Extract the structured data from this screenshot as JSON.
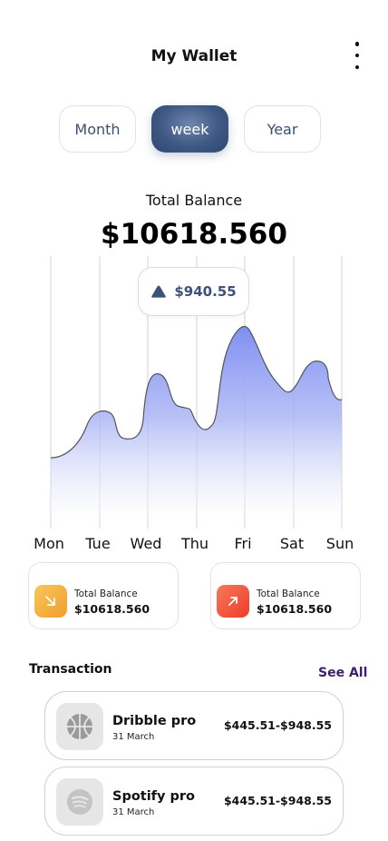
{
  "header": {
    "title": "My Wallet"
  },
  "tabs": [
    {
      "label": "Month",
      "active": false
    },
    {
      "label": "week",
      "active": true
    },
    {
      "label": "Year",
      "active": false
    }
  ],
  "balance": {
    "label": "Total Balance",
    "amount": "$10618.560"
  },
  "chart_data": {
    "type": "area",
    "categories": [
      "Mon",
      "Tue",
      "Wed",
      "Thu",
      "Fri",
      "Sat",
      "Sun"
    ],
    "tooltip": {
      "value": "$940.55",
      "category": "Fri"
    },
    "line_color": "#555555",
    "fill_top_color": "#7f8ff2"
  },
  "stats": [
    {
      "label": "Total Balance",
      "value": "$10618.560",
      "icon": "arrow-down-right-icon",
      "color": "#f4a73a"
    },
    {
      "label": "Total Balance",
      "value": "$10618.560",
      "icon": "arrow-up-right-icon",
      "color": "#f0513c"
    }
  ],
  "transactions": {
    "title": "Transaction",
    "see_all": "See All",
    "items": [
      {
        "name": "Dribble pro",
        "date": "31 March",
        "amount": "$445.51-$948.55",
        "icon": "dribbble-icon"
      },
      {
        "name": "Spotify pro",
        "date": "31 March",
        "amount": "$445.51-$948.55",
        "icon": "spotify-icon"
      }
    ]
  }
}
